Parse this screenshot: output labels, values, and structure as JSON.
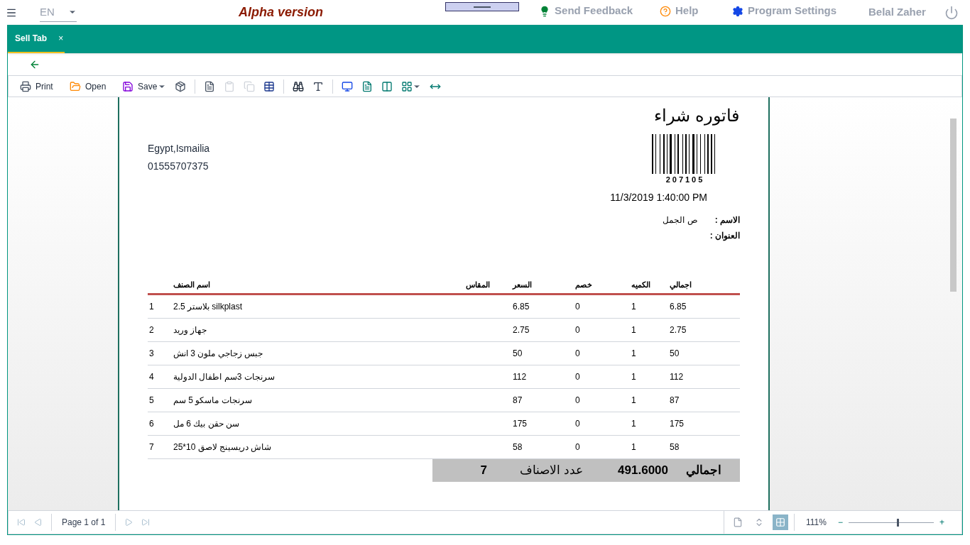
{
  "top_bar": {
    "language": "EN",
    "version": "Alpha version",
    "feedback_link": "Send Feedback",
    "help_link": "Help",
    "settings_link": "Program Settings",
    "user": "Belal Zaher"
  },
  "tabs": [
    {
      "label": "Sell Tab",
      "selected": true,
      "close": "×"
    }
  ],
  "toolbar": {
    "print_button": "Print",
    "open_button": "Open",
    "save_button": "Save"
  },
  "document": {
    "title": "فاتوره شراء",
    "address": "Egypt,Ismailia",
    "phone": "01555707375",
    "barcode": "207105",
    "date": "11/3/2019 1:40:00 PM",
    "fields": [
      {
        "label": "الاسم :",
        "value": "ص الجمل"
      },
      {
        "label": "العنوان :"
      }
    ],
    "table": {
      "columns": [
        "اجمالي",
        "الكميه",
        "خصم",
        "السعر",
        "المقاس",
        "اسم الصنف"
      ],
      "rows": [
        {
          "cells": [
            "6.85",
            "1",
            "0",
            "6.85",
            null,
            "silkplast  بلاستر 2.5"
          ],
          "no": "1"
        },
        {
          "cells": [
            "2.75",
            "1",
            "0",
            "2.75",
            null,
            "جهاز وريد"
          ],
          "no": "2"
        },
        {
          "cells": [
            "50",
            "1",
            "0",
            "50",
            null,
            "جبس زجاجي ملون 3 انش"
          ],
          "no": "3"
        },
        {
          "cells": [
            "112",
            "1",
            "0",
            "112",
            null,
            "سرنجات 3سم اطفال الدولية"
          ],
          "no": "4"
        },
        {
          "cells": [
            "87",
            "1",
            "0",
            "87",
            null,
            "سرنجات ماسكو 5 سم"
          ],
          "no": "5"
        },
        {
          "cells": [
            "175",
            "1",
            "0",
            "175",
            null,
            "سن حقن بيك 6 مل"
          ],
          "no": "6"
        },
        {
          "cells": [
            "58",
            "1",
            "0",
            "58",
            null,
            "شاش دريسينج لاصق 10*25"
          ],
          "no": "7"
        }
      ]
    },
    "summary": {
      "total_label": "اجمالي",
      "total": "491.6000",
      "count_label": "عدد الاصناف",
      "count": "7"
    }
  },
  "status_bar": {
    "page": "Page 1 of 1",
    "view_modes": [
      {
        "kind": "single",
        "selected": false
      },
      {
        "kind": "fit",
        "selected": false
      },
      {
        "kind": "multi",
        "selected": true
      }
    ],
    "zoom": "111%",
    "zoom_slider": {
      "level": 0.57,
      "minus": "−",
      "plus": "+"
    }
  }
}
